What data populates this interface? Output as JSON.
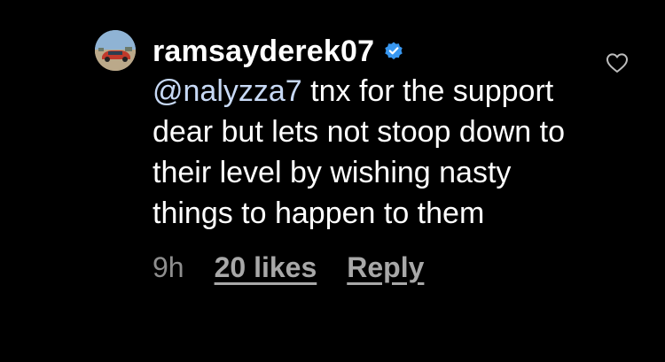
{
  "comment": {
    "username": "ramsayderek07",
    "verified": true,
    "mention": "@nalyzza7",
    "text": " tnx for the support dear but lets not stoop down to their level by wishing nasty things to happen to them",
    "time": "9h",
    "likes": "20 likes",
    "reply_label": "Reply"
  },
  "icons": {
    "avatar": "profile-photo-red-car",
    "verified": "verified-badge-icon",
    "like": "heart-outline-icon"
  },
  "colors": {
    "background": "#000000",
    "text": "#ffffff",
    "mention": "#c7d9f5",
    "meta": "#8e8e8e",
    "verified": "#3897f0"
  }
}
